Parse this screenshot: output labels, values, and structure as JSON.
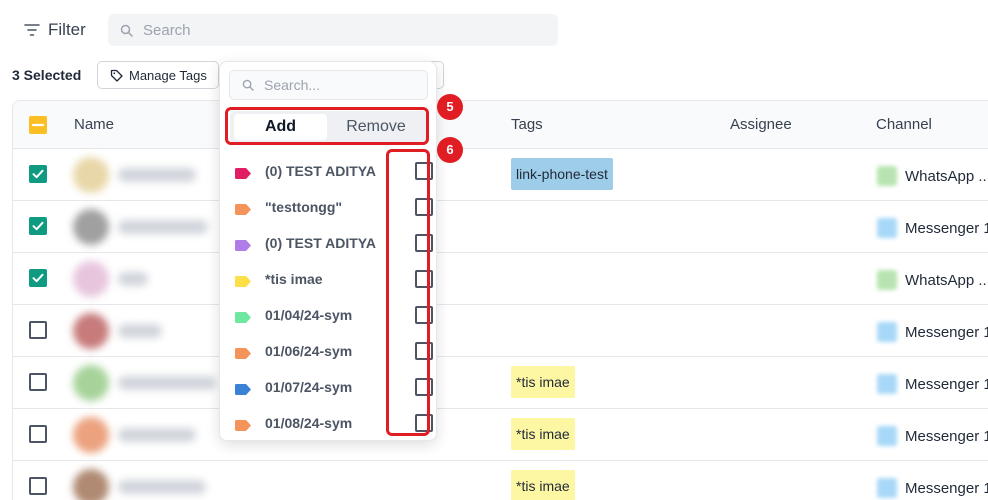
{
  "toolbar": {
    "filter_label": "Filter",
    "search_placeholder": "Search",
    "selected_count_label": "3 Selected",
    "manage_tags_label": "Manage Tags"
  },
  "table": {
    "columns": [
      "Name",
      "Tags",
      "Assignee",
      "Channel"
    ],
    "header_checkbox_state": "partial",
    "rows": [
      {
        "checked": true,
        "avatar_color": "#e8d7a8",
        "tag": "link-phone-test",
        "tag_color": "blue",
        "channel": "WhatsApp ...",
        "channel_type": "whatsapp"
      },
      {
        "checked": true,
        "avatar_color": "#a0a0a0",
        "tag": "",
        "tag_color": "",
        "channel": "Messenger 1",
        "channel_type": "messenger"
      },
      {
        "checked": true,
        "avatar_color": "#e7c5dd",
        "tag": "",
        "tag_color": "",
        "channel": "WhatsApp ...",
        "channel_type": "whatsapp"
      },
      {
        "checked": false,
        "avatar_color": "#c77b7b",
        "tag": "",
        "tag_color": "",
        "channel": "Messenger 1",
        "channel_type": "messenger"
      },
      {
        "checked": false,
        "avatar_color": "#a7d39a",
        "tag": "*tis imae",
        "tag_color": "yellow",
        "channel": "Messenger 1",
        "channel_type": "messenger"
      },
      {
        "checked": false,
        "avatar_color": "#eca27f",
        "tag": "*tis imae",
        "tag_color": "yellow",
        "channel": "Messenger 1",
        "channel_type": "messenger"
      },
      {
        "checked": false,
        "avatar_color": "#b08a73",
        "tag": "*tis imae",
        "tag_color": "yellow",
        "channel": "Messenger 1",
        "channel_type": "messenger"
      }
    ]
  },
  "manage_tags_popover": {
    "search_placeholder": "Search...",
    "add_label": "Add",
    "remove_label": "Remove",
    "active_mode": "Add",
    "step_badges": [
      "5",
      "6"
    ],
    "tags": [
      {
        "label": "(0) TEST ADITYA",
        "color": "#e11d63",
        "checked": false
      },
      {
        "label": "\"testtongg\"",
        "color": "#f4935a",
        "checked": false
      },
      {
        "label": "(0) TEST ADITYA",
        "color": "#b07ce8",
        "checked": false
      },
      {
        "label": "*tis imae",
        "color": "#fde047",
        "checked": false
      },
      {
        "label": "01/04/24-sym",
        "color": "#6ee7a0",
        "checked": false
      },
      {
        "label": "01/06/24-sym",
        "color": "#f4935a",
        "checked": false
      },
      {
        "label": "01/07/24-sym",
        "color": "#3b82d6",
        "checked": false
      },
      {
        "label": "01/08/24-sym",
        "color": "#f4935a",
        "checked": false
      }
    ]
  },
  "colors": {
    "checkbox_checked": "#0f9b82",
    "checkbox_partial": "#fbbf24",
    "highlight_red": "#e11d24",
    "tag_blue": "#9ecdea",
    "tag_yellow": "#fdf6a3"
  }
}
